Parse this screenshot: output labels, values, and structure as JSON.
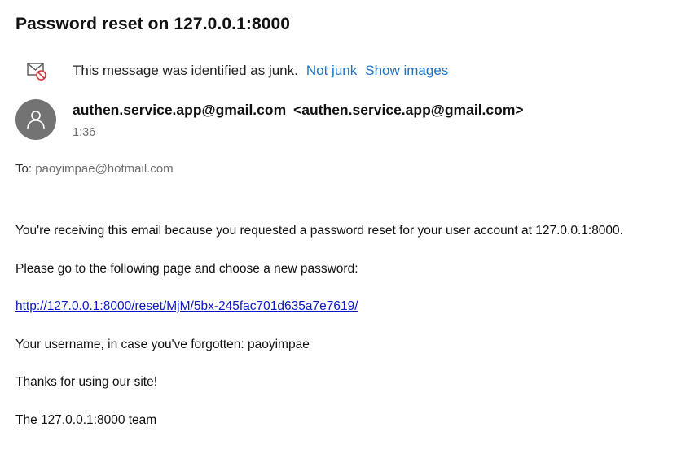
{
  "email": {
    "subject": "Password reset on 127.0.0.1:8000",
    "junk_notice": {
      "message": "This message was identified as junk.",
      "not_junk_label": "Not junk",
      "show_images_label": "Show images"
    },
    "sender": {
      "name": "authen.service.app@gmail.com",
      "address": "<authen.service.app@gmail.com>",
      "time": "1:36"
    },
    "to": {
      "label": "To:",
      "address": "paoyimpae@hotmail.com"
    },
    "body": {
      "line1": "You're receiving this email because you requested a password reset for your user account at 127.0.0.1:8000.",
      "line2": "Please go to the following page and choose a new password:",
      "reset_link": "http://127.0.0.1:8000/reset/MjM/5bx-245fac701d635a7e7619/",
      "line3": "Your username, in case you've forgotten: paoyimpae",
      "line4": "Thanks for using our site!",
      "line5": "The 127.0.0.1:8000 team"
    }
  },
  "colors": {
    "link_blue": "#1a73c8",
    "body_link": "#0b18c6",
    "avatar_bg": "#737373",
    "junk_icon_red": "#d13438"
  },
  "icons": {
    "junk": "junk-mail-icon",
    "avatar": "person-icon"
  }
}
